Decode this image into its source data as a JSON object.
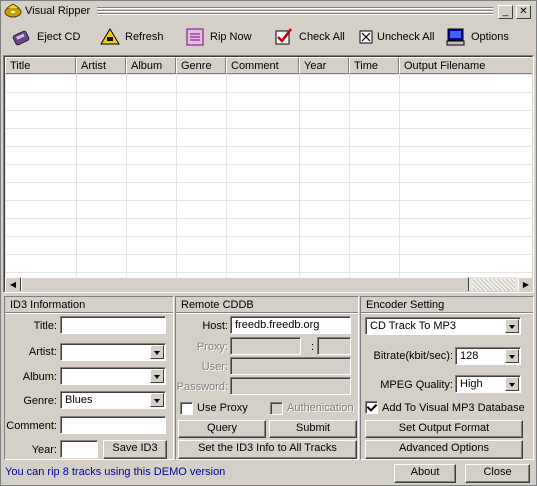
{
  "window": {
    "title": "Visual Ripper",
    "minimize_label": "_",
    "close_label": "✕"
  },
  "toolbar": {
    "eject_label": "Eject CD",
    "refresh_label": "Refresh",
    "rip_label": "Rip Now",
    "check_all_label": "Check All",
    "uncheck_all_label": "Uncheck All",
    "options_label": "Options"
  },
  "grid": {
    "columns": [
      "Title",
      "Artist",
      "Album",
      "Genre",
      "Comment",
      "Year",
      "Time",
      "Output Filename"
    ]
  },
  "id3": {
    "header": "ID3 Information",
    "title_label": "Title:",
    "title_value": "",
    "artist_label": "Artist:",
    "artist_value": "",
    "album_label": "Album:",
    "album_value": "",
    "genre_label": "Genre:",
    "genre_value": "Blues",
    "comment_label": "Comment:",
    "comment_value": "",
    "year_label": "Year:",
    "year_value": "",
    "save_label": "Save ID3"
  },
  "cddb": {
    "header": "Remote CDDB",
    "host_label": "Host:",
    "host_value": "freedb.freedb.org",
    "proxy_label": "Proxy:",
    "proxy_value": "",
    "port_sep": ":",
    "port_value": "",
    "user_label": "User:",
    "user_value": "",
    "password_label": "Password:",
    "password_value": "",
    "use_proxy_label": "Use Proxy",
    "auth_label": "Authenication",
    "query_label": "Query",
    "submit_label": "Submit",
    "set_all_label": "Set the ID3 Info to All Tracks"
  },
  "encoder": {
    "header": "Encoder Setting",
    "mode_value": "CD Track To MP3",
    "bitrate_label": "Bitrate(kbit/sec):",
    "bitrate_value": "128",
    "quality_label": "MPEG Quality:",
    "quality_value": "High",
    "add_db_label": "Add To Visual MP3 Database",
    "output_format_label": "Set Output Format",
    "advanced_label": "Advanced Options"
  },
  "footer": {
    "status_text": "You can rip 8 tracks using this DEMO version",
    "about_label": "About",
    "close_label": "Close"
  }
}
